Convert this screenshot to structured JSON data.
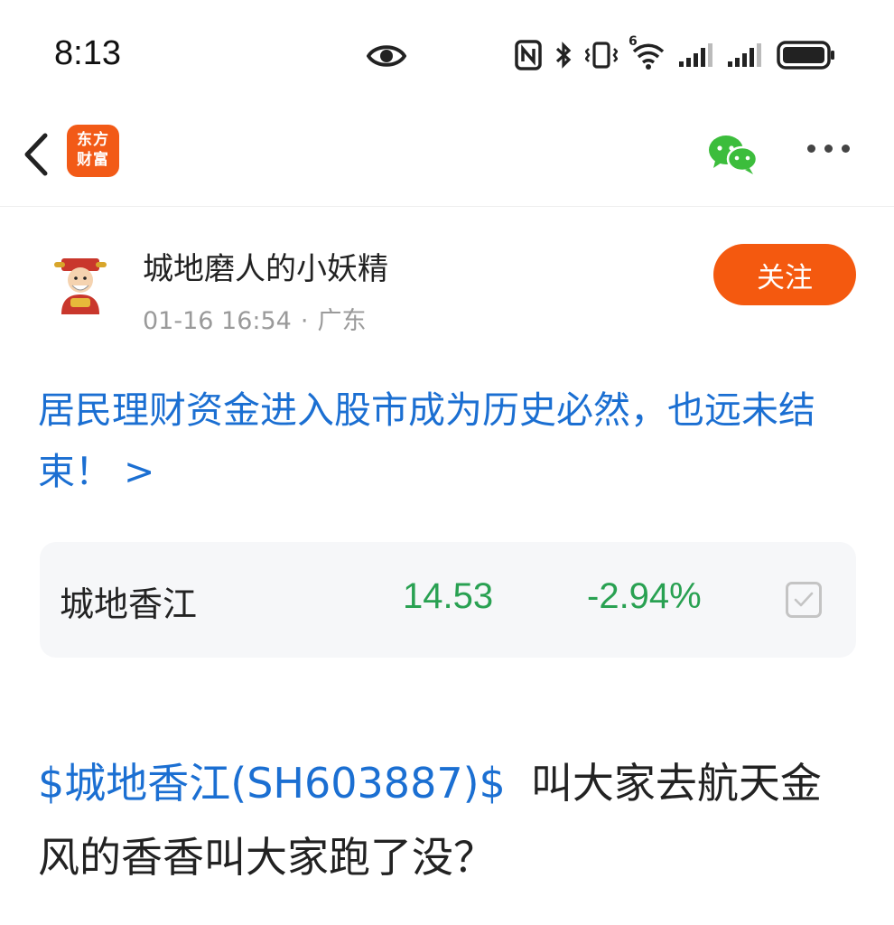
{
  "status_bar": {
    "time": "8:13",
    "icons": [
      "eye-icon",
      "nfc-icon",
      "bluetooth-icon",
      "vibrate-icon",
      "wifi-icon",
      "signal-icon",
      "signal-icon",
      "battery-icon"
    ],
    "wifi_badge": "6"
  },
  "nav": {
    "app_logo_line1": "东方",
    "app_logo_line2": "财富",
    "brand_color": "#f25a17"
  },
  "author": {
    "name": "城地磨人的小妖精",
    "date": "01-16 16:54",
    "separator": "·",
    "location": "广东",
    "follow_label": "关注"
  },
  "post": {
    "title": "居民理财资金进入股市成为历史必然，也远未结束！ >",
    "stock": {
      "name": "城地香江",
      "price": "14.53",
      "change": "-2.94%",
      "change_color": "#29a152"
    },
    "tag": "$城地香江(SH603887)$",
    "body": "叫大家去航天金风的香香叫大家跑了没？"
  },
  "colors": {
    "link": "#1b6fd2",
    "follow_button": "#f4590f"
  }
}
